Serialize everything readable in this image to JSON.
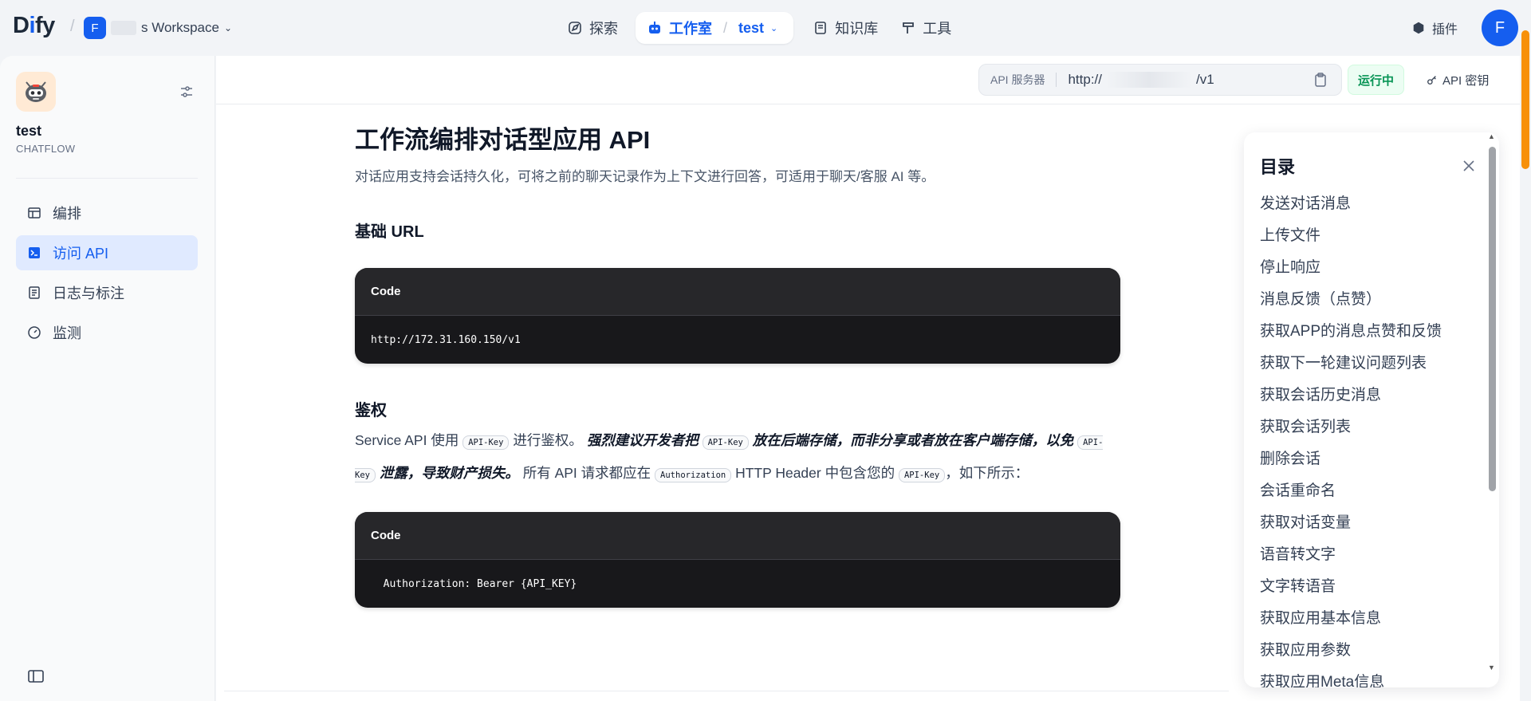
{
  "header": {
    "logo_text": "Dify",
    "workspace": {
      "avatar_letter": "F",
      "name": "s Workspace"
    },
    "nav": {
      "explore": "探索",
      "studio": "工作室",
      "app_name": "test",
      "knowledge": "知识库",
      "tools": "工具"
    },
    "plugins": "插件",
    "user_avatar": "F"
  },
  "sidebar": {
    "app_title": "test",
    "app_type": "CHATFLOW",
    "items": [
      {
        "label": "编排",
        "icon": "layout-icon"
      },
      {
        "label": "访问 API",
        "icon": "terminal-icon",
        "active": true
      },
      {
        "label": "日志与标注",
        "icon": "file-list-icon"
      },
      {
        "label": "监测",
        "icon": "dashboard-icon"
      }
    ]
  },
  "apibar": {
    "server_label": "API 服务器",
    "server_url_start": "http://",
    "server_url_end": "/v1",
    "status": "运行中",
    "api_key_label": "API 密钥"
  },
  "doc": {
    "title": "工作流编排对话型应用 API",
    "description": "对话应用支持会话持久化，可将之前的聊天记录作为上下文进行回答，可适用于聊天/客服 AI 等。",
    "base_url": {
      "heading": "基础 URL",
      "code_label": "Code",
      "code": "http://172.31.160.150/v1"
    },
    "auth": {
      "heading": "鉴权",
      "p1": "Service API 使用",
      "code_apikey": "API-Key",
      "p2": "进行鉴权。",
      "strong1": "强烈建议开发者把",
      "strong2": "放在后端存储，而非分享或者放在客户端存储，以免",
      "strong3": "泄露，导致财产损失。",
      "p3": "所有 API 请求都应在",
      "code_authorization": "Authorization",
      "p4": "HTTP Header 中包含您的",
      "p5": "，如下所示：",
      "code_label": "Code",
      "code": "  Authorization: Bearer {API_KEY}"
    }
  },
  "toc": {
    "title": "目录",
    "items": [
      "发送对话消息",
      "上传文件",
      "停止响应",
      "消息反馈（点赞）",
      "获取APP的消息点赞和反馈",
      "获取下一轮建议问题列表",
      "获取会话历史消息",
      "获取会话列表",
      "删除会话",
      "会话重命名",
      "获取对话变量",
      "语音转文字",
      "文字转语音",
      "获取应用基本信息",
      "获取应用参数",
      "获取应用Meta信息"
    ]
  },
  "colors": {
    "accent": "#155eef",
    "status_green": "#079455",
    "code_bg": "#18181b",
    "scroll_thumb": "#f79009"
  }
}
